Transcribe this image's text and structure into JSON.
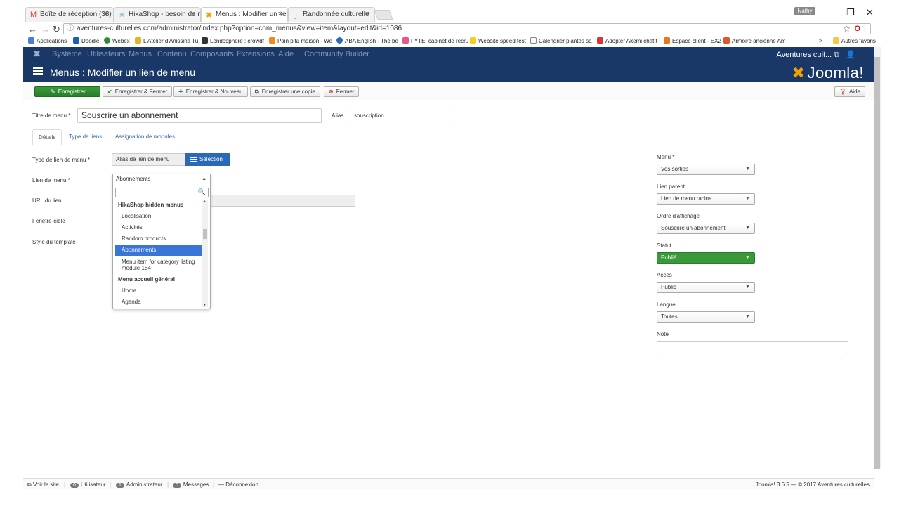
{
  "browser": {
    "tabs": [
      {
        "title": "Boîte de réception (38) -",
        "icon": "gmail-icon"
      },
      {
        "title": "HikaShop - besoin de m",
        "icon": "hikashop-icon"
      },
      {
        "title": "Menus : Modifier un lien",
        "icon": "joomla-icon",
        "active": true
      },
      {
        "title": "Randonnée culturelle",
        "icon": "page-icon"
      }
    ],
    "profile": "Nathy",
    "url": "aventures-culturelles.com/administrator/index.php?option=com_menus&view=item&layout=edit&id=1086",
    "bookmarks": [
      "Applications",
      "Doodle",
      "Webex",
      "L'Atelier d'Anissina Tu",
      "Lendosphere : crowdf",
      "Pain pita maison - We",
      "ABA English - The be",
      "FYTE, cabinet de recru",
      "Website speed test",
      "Calendrier plantes sa",
      "Adopter Akemi chat t",
      "Espace client - EX2",
      "Armoire ancienne Am"
    ],
    "bookmarks_more": "»",
    "other_bookmarks": "Autres favoris"
  },
  "joomla": {
    "topnav": [
      "Système",
      "Utilisateurs",
      "Menus",
      "Contenu",
      "Composants",
      "Extensions",
      "Aide",
      "Community Builder"
    ],
    "site_name": "Aventures cult...",
    "page_title": "Menus : Modifier un lien de menu",
    "brand": "Joomla!",
    "toolbar": {
      "save": "Enregistrer",
      "save_close": "Enregistrer & Fermer",
      "save_new": "Enregistrer & Nouveau",
      "save_copy": "Enregistrer une copie",
      "close": "Fermer",
      "help": "Aide"
    },
    "form": {
      "title_label": "Titre de menu *",
      "title_value": "Souscrire un abonnement",
      "alias_label": "Alias",
      "alias_value": "souscription",
      "tabs": [
        "Détails",
        "Type de liens",
        "Assignation de modules"
      ],
      "type_label": "Type de lien de menu *",
      "type_value": "Alias de lien de menu",
      "select_button": "Sélection",
      "link_label": "Lien de menu *",
      "link_value": "Abonnements",
      "url_label": "URL du lien",
      "target_label": "Fenêtre-cible",
      "template_label": "Style du template"
    },
    "dropdown": {
      "options": [
        {
          "label": "HikaShop hidden menus",
          "group": true
        },
        {
          "label": "Localisation"
        },
        {
          "label": "Activités"
        },
        {
          "label": "Random products"
        },
        {
          "label": "Abonnements",
          "selected": true
        },
        {
          "label": "Menu item for category listing module 184"
        },
        {
          "label": "Menu accueil général",
          "group": true
        },
        {
          "label": "Home"
        },
        {
          "label": "Agenda"
        }
      ]
    },
    "sidebar": {
      "menu_label": "Menu *",
      "menu_value": "Vos sorties",
      "parent_label": "Lien parent",
      "parent_value": "Lien de menu racine",
      "order_label": "Ordre d'affichage",
      "order_value": "Souscrire un abonnement",
      "status_label": "Statut",
      "status_value": "Publié",
      "access_label": "Accès",
      "access_value": "Public",
      "language_label": "Langue",
      "language_value": "Toutes",
      "note_label": "Note",
      "note_value": ""
    },
    "footer": {
      "view_site": "Voir le site",
      "users_count": "0",
      "users_label": "Utilisateur",
      "admins_count": "1",
      "admins_label": "Administrateur",
      "messages_count": "0",
      "messages_label": "Messages",
      "logout": "Déconnexion",
      "copyright": "Joomla! 3.6.5 — © 2017 Aventures culturelles"
    }
  }
}
